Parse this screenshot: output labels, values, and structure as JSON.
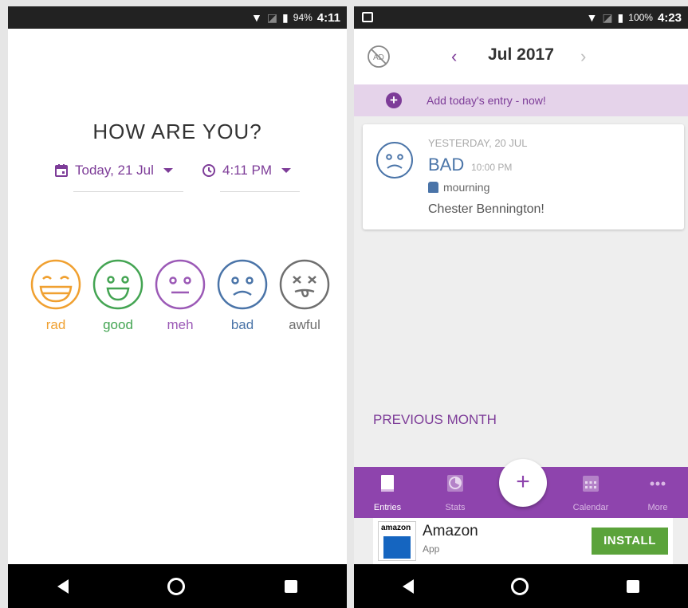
{
  "left_screen": {
    "status": {
      "battery": "94%",
      "time": "4:11"
    },
    "title": "HOW ARE YOU?",
    "date_picker": {
      "value": "Today, 21 Jul"
    },
    "time_picker": {
      "value": "4:11 PM"
    },
    "moods": [
      {
        "label": "rad",
        "color": "#f0a030"
      },
      {
        "label": "good",
        "color": "#43a452"
      },
      {
        "label": "meh",
        "color": "#9b59b6"
      },
      {
        "label": "bad",
        "color": "#4a74a8"
      },
      {
        "label": "awful",
        "color": "#6f6f6f"
      }
    ]
  },
  "right_screen": {
    "status": {
      "battery": "100%",
      "time": "4:23"
    },
    "header": {
      "month": "Jul 2017",
      "prev": "‹",
      "next": "›"
    },
    "add_entry": {
      "icon": "+",
      "text": "Add today's entry - now!"
    },
    "entry": {
      "date": "YESTERDAY, 20 JUL",
      "mood": "BAD",
      "time": "10:00 PM",
      "activity": "mourning",
      "note": "Chester Bennington!"
    },
    "previous_month": "PREVIOUS MONTH",
    "tabs": [
      {
        "label": "Entries"
      },
      {
        "label": "Stats"
      },
      {
        "label": "Calendar"
      },
      {
        "label": "More"
      }
    ],
    "fab": "+",
    "ad": {
      "logo_text": "amazon",
      "title": "Amazon",
      "subtitle": "App",
      "button": "INSTALL"
    }
  },
  "colors": {
    "accent": "#8e44ad",
    "accent_text": "#7d3c98",
    "add_bar": "#e5d3ea",
    "install": "#5ba33b"
  },
  "icons": {
    "status": [
      "wifi-icon",
      "no-sim-icon",
      "battery-icon"
    ],
    "left_pickers": [
      "calendar-icon",
      "clock-icon"
    ],
    "right_header": [
      "no-ads-icon",
      "chevron-left-icon",
      "chevron-right-icon"
    ],
    "tabs": [
      "book-icon",
      "stats-chart-icon",
      "calendar-icon",
      "more-dots-icon"
    ]
  }
}
